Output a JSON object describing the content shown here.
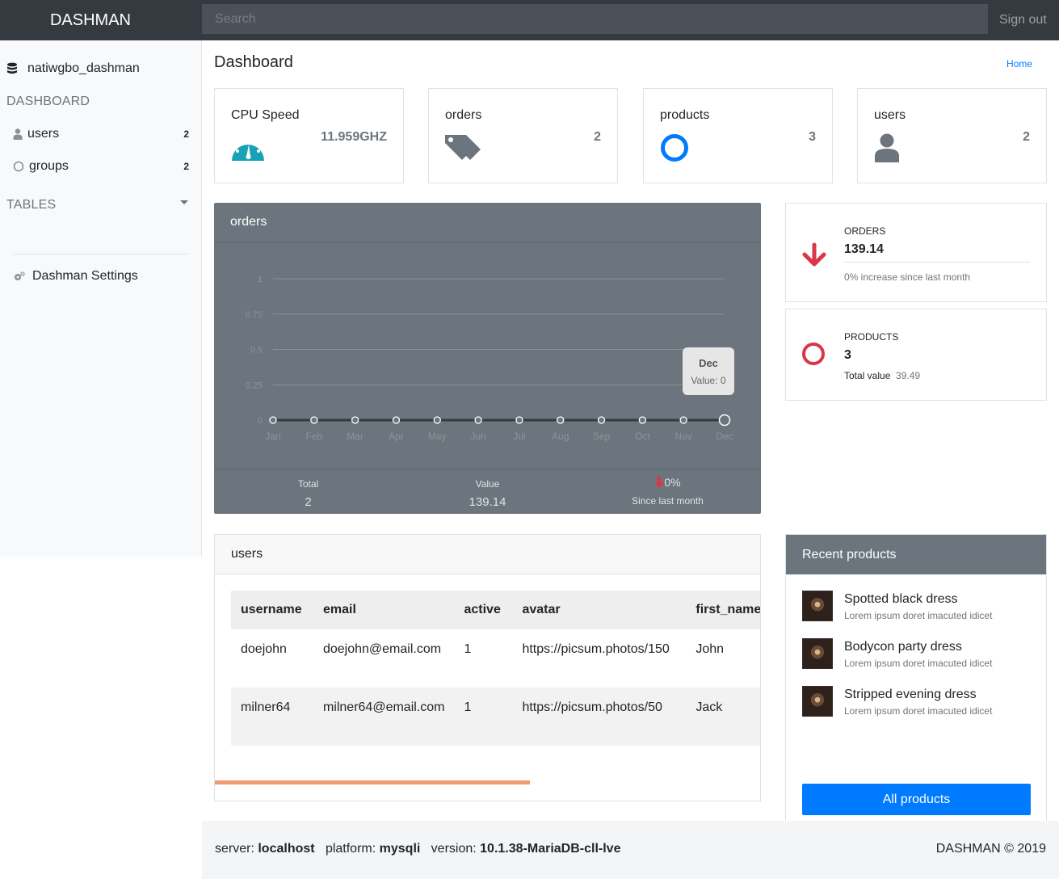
{
  "app": {
    "brand": "DASHMAN",
    "sign_out": "Sign out"
  },
  "search": {
    "placeholder": "Search"
  },
  "sidebar": {
    "database": "natiwgbo_dashman",
    "dashboard_heading": "DASHBOARD",
    "items": [
      {
        "label": "users",
        "count": "2",
        "icon": "user-icon"
      },
      {
        "label": "groups",
        "count": "2",
        "icon": "circle-icon"
      }
    ],
    "tables_heading": "TABLES",
    "settings": "Dashman Settings"
  },
  "main": {
    "title": "Dashboard",
    "breadcrumb": "Home"
  },
  "stats": [
    {
      "title": "CPU Speed",
      "value": "11.959GHZ",
      "icon": "speedometer-icon",
      "color": "#17a2b8"
    },
    {
      "title": "orders",
      "value": "2",
      "icon": "tags-icon",
      "color": "#6c757d"
    },
    {
      "title": "products",
      "value": "3",
      "icon": "circle-icon",
      "color": "#007bff"
    },
    {
      "title": "users",
      "value": "2",
      "icon": "user-icon",
      "color": "#6c757d"
    }
  ],
  "orders_card": {
    "title": "orders",
    "tooltip": {
      "month": "Dec",
      "text": "Value: 0"
    },
    "footer": {
      "total_label": "Total",
      "total_value": "2",
      "value_label": "Value",
      "value_value": "139.14",
      "change_value": "0%",
      "change_label": "Since last month"
    }
  },
  "chart_data": {
    "type": "line",
    "categories": [
      "Jan",
      "Feb",
      "Mar",
      "Apr",
      "May",
      "Jun",
      "Jul",
      "Aug",
      "Sep",
      "Oct",
      "Nov",
      "Dec"
    ],
    "values": [
      0,
      0,
      0,
      0,
      0,
      0,
      0,
      0,
      0,
      0,
      0,
      0
    ],
    "yticks": [
      "0",
      "0.25",
      "0.5",
      "0.75",
      "1"
    ],
    "ylim": [
      0,
      1
    ],
    "grid": true,
    "line_color": "#343a40"
  },
  "info_orders": {
    "caption": "ORDERS",
    "value": "139.14",
    "sub": "0% increase since last month",
    "icon": "arrow-down-icon",
    "color": "#dc3545"
  },
  "info_products": {
    "caption": "PRODUCTS",
    "value": "3",
    "sub_label": "Total value",
    "sub_value": "39.49",
    "icon": "circle-icon",
    "color": "#dc3545"
  },
  "users_table": {
    "title": "users",
    "columns": [
      "username",
      "email",
      "active",
      "avatar",
      "first_name"
    ],
    "rows": [
      [
        "doejohn",
        "doejohn@email.com",
        "1",
        "https://picsum.photos/150",
        "John"
      ],
      [
        "milner64",
        "milner64@email.com",
        "1",
        "https://picsum.photos/50",
        "Jack"
      ]
    ]
  },
  "recent_products": {
    "title": "Recent products",
    "items": [
      {
        "name": "Spotted black dress",
        "desc": "Lorem ipsum doret imacuted idicet"
      },
      {
        "name": "Bodycon party dress",
        "desc": "Lorem ipsum doret imacuted idicet"
      },
      {
        "name": "Stripped evening dress",
        "desc": "Lorem ipsum doret imacuted idicet"
      }
    ],
    "button": "All products"
  },
  "footer": {
    "server_label": "server:",
    "server": "localhost",
    "platform_label": "platform:",
    "platform": "mysqli",
    "version_label": "version:",
    "version": "10.1.38-MariaDB-cll-lve",
    "copyright": "DASHMAN © 2019"
  }
}
